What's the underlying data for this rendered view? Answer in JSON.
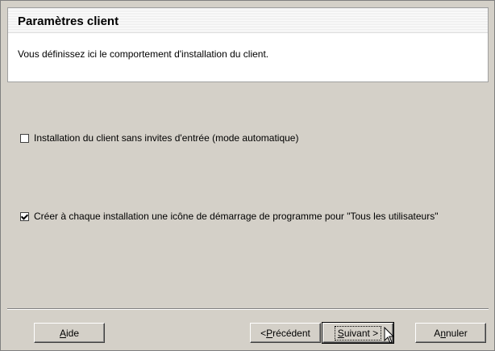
{
  "header": {
    "title": "Paramètres client",
    "description": "Vous définissez ici le comportement d'installation du client."
  },
  "options": [
    {
      "label": "Installation du client sans invites d'entrée (mode automatique)",
      "checked": false
    },
    {
      "label": "Créer à chaque installation une icône de démarrage de programme pour \"Tous les utilisateurs\"",
      "checked": true
    }
  ],
  "buttons": {
    "help": {
      "accel": "A",
      "rest": "ide"
    },
    "back": {
      "prefix": "<",
      "accel": "P",
      "rest": "récédent"
    },
    "next": {
      "accel": "S",
      "rest": "uivant >"
    },
    "cancel": {
      "pre": "A",
      "accel": "n",
      "rest": "nuler"
    }
  },
  "icons": {
    "cursor": "arrow-cursor-icon"
  }
}
